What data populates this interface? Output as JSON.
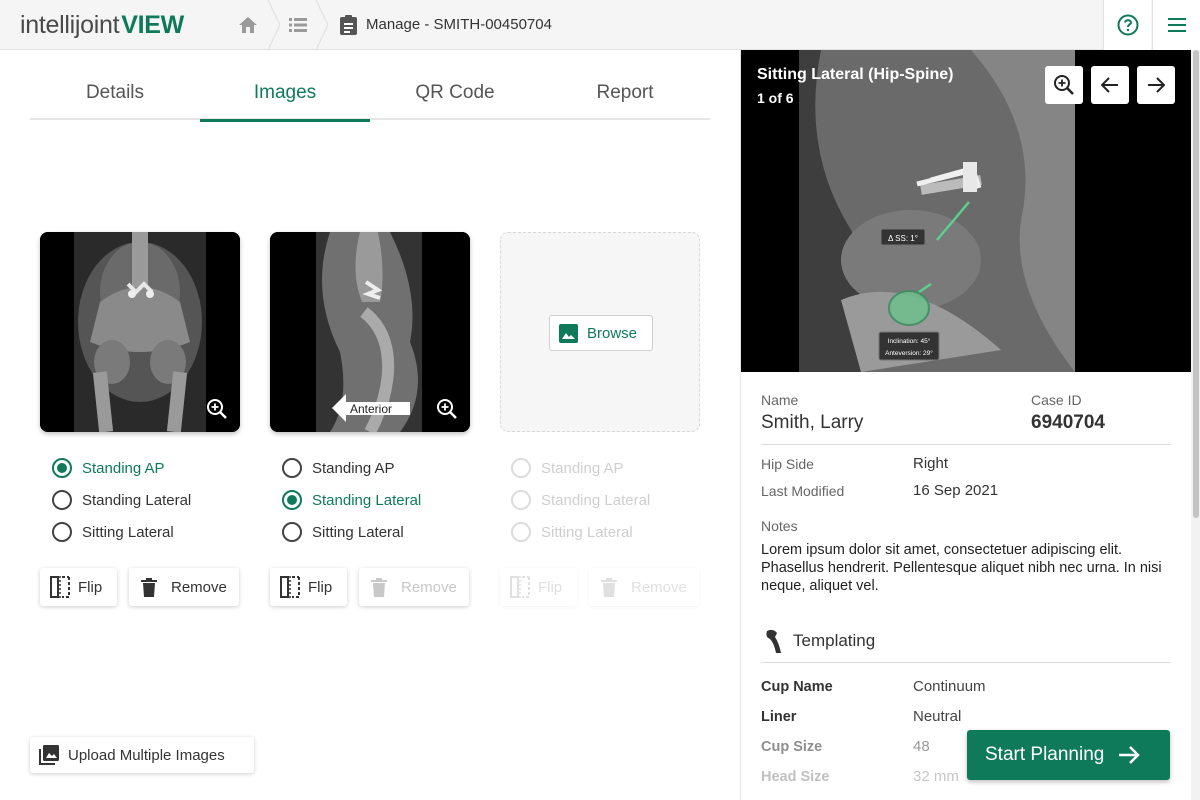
{
  "app": {
    "logo_part1": "intellijoint",
    "logo_part2": "VIEW"
  },
  "breadcrumb": {
    "current": "Manage - SMITH-00450704"
  },
  "tabs": [
    {
      "label": "Details",
      "active": false
    },
    {
      "label": "Images",
      "active": true
    },
    {
      "label": "QR Code",
      "active": false
    },
    {
      "label": "Report",
      "active": false
    }
  ],
  "slots": [
    {
      "image": "standing-ap-xray",
      "options": [
        {
          "label": "Standing AP",
          "state": "checked"
        },
        {
          "label": "Standing Lateral",
          "state": "unchecked"
        },
        {
          "label": "Sitting Lateral",
          "state": "unchecked"
        }
      ],
      "flip_label": "Flip",
      "remove_label": "Remove"
    },
    {
      "image": "standing-lateral-xray",
      "marker_label": "Anterior",
      "options": [
        {
          "label": "Standing AP",
          "state": "unchecked"
        },
        {
          "label": "Standing Lateral",
          "state": "checked"
        },
        {
          "label": "Sitting Lateral",
          "state": "unchecked"
        }
      ],
      "flip_label": "Flip",
      "remove_label": "Remove"
    },
    {
      "image": null,
      "browse_label": "Browse",
      "options": [
        {
          "label": "Standing AP",
          "state": "disabled"
        },
        {
          "label": "Standing Lateral",
          "state": "disabled"
        },
        {
          "label": "Sitting Lateral",
          "state": "disabled"
        }
      ],
      "flip_label": "Flip",
      "remove_label": "Remove"
    }
  ],
  "upload_label": "Upload Multiple Images",
  "viewer": {
    "title": "Sitting Lateral (Hip-Spine)",
    "counter": "1 of 6",
    "overlay_ss": "Δ SS: 1°",
    "overlay_inclination": "Inclination: 45°",
    "overlay_anteversion": "Anteversion: 29°"
  },
  "patient": {
    "name_label": "Name",
    "name": "Smith, Larry",
    "case_label": "Case ID",
    "case_id": "6940704",
    "hip_side_label": "Hip Side",
    "hip_side": "Right",
    "modified_label": "Last Modified",
    "modified": "16 Sep 2021",
    "notes_label": "Notes",
    "notes": "Lorem ipsum dolor sit amet, consectetuer adipiscing elit. Phasellus hendrerit. Pellentesque aliquet nibh nec urna. In nisi neque, aliquet vel."
  },
  "templating": {
    "title": "Templating",
    "rows": [
      {
        "key": "Cup Name",
        "value": "Continuum"
      },
      {
        "key": "Liner",
        "value": "Neutral"
      },
      {
        "key": "Cup Size",
        "value": "48"
      },
      {
        "key": "Head Size",
        "value": "32 mm"
      }
    ]
  },
  "start_label": "Start Planning",
  "colors": {
    "brand": "#0f7a5a"
  }
}
